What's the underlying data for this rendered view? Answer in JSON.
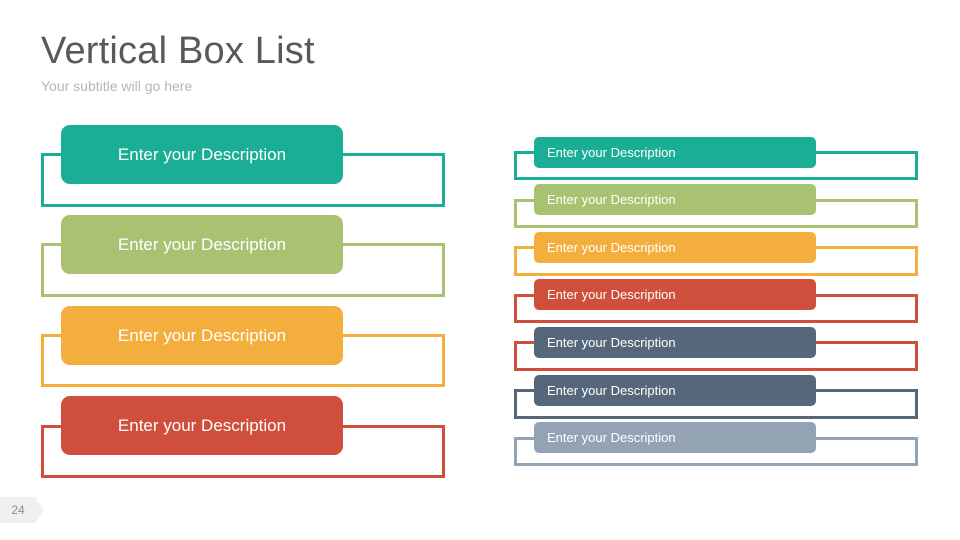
{
  "slide": {
    "title": "Vertical Box List",
    "subtitle": "Your subtitle will go here",
    "page_number": "24"
  },
  "left_list": [
    {
      "label": "Enter your Description",
      "color": "#1aae96"
    },
    {
      "label": "Enter your Description",
      "color": "#a8c272"
    },
    {
      "label": "Enter your Description",
      "color": "#f4ae3d"
    },
    {
      "label": "Enter your Description",
      "color": "#cf4f3c"
    }
  ],
  "right_list": [
    {
      "label": "Enter your Description",
      "color": "#1aae96"
    },
    {
      "label": "Enter your Description",
      "color": "#a8c272"
    },
    {
      "label": "Enter your Description",
      "color": "#f4ae3d"
    },
    {
      "label": "Enter your Description",
      "color": "#cf4f3c"
    },
    {
      "label": "Enter your Description",
      "color": "#56677b",
      "frame_color": "#cf4f3c"
    },
    {
      "label": "Enter your Description",
      "color": "#56677b"
    },
    {
      "label": "Enter your Description",
      "color": "#93a3b3"
    }
  ]
}
